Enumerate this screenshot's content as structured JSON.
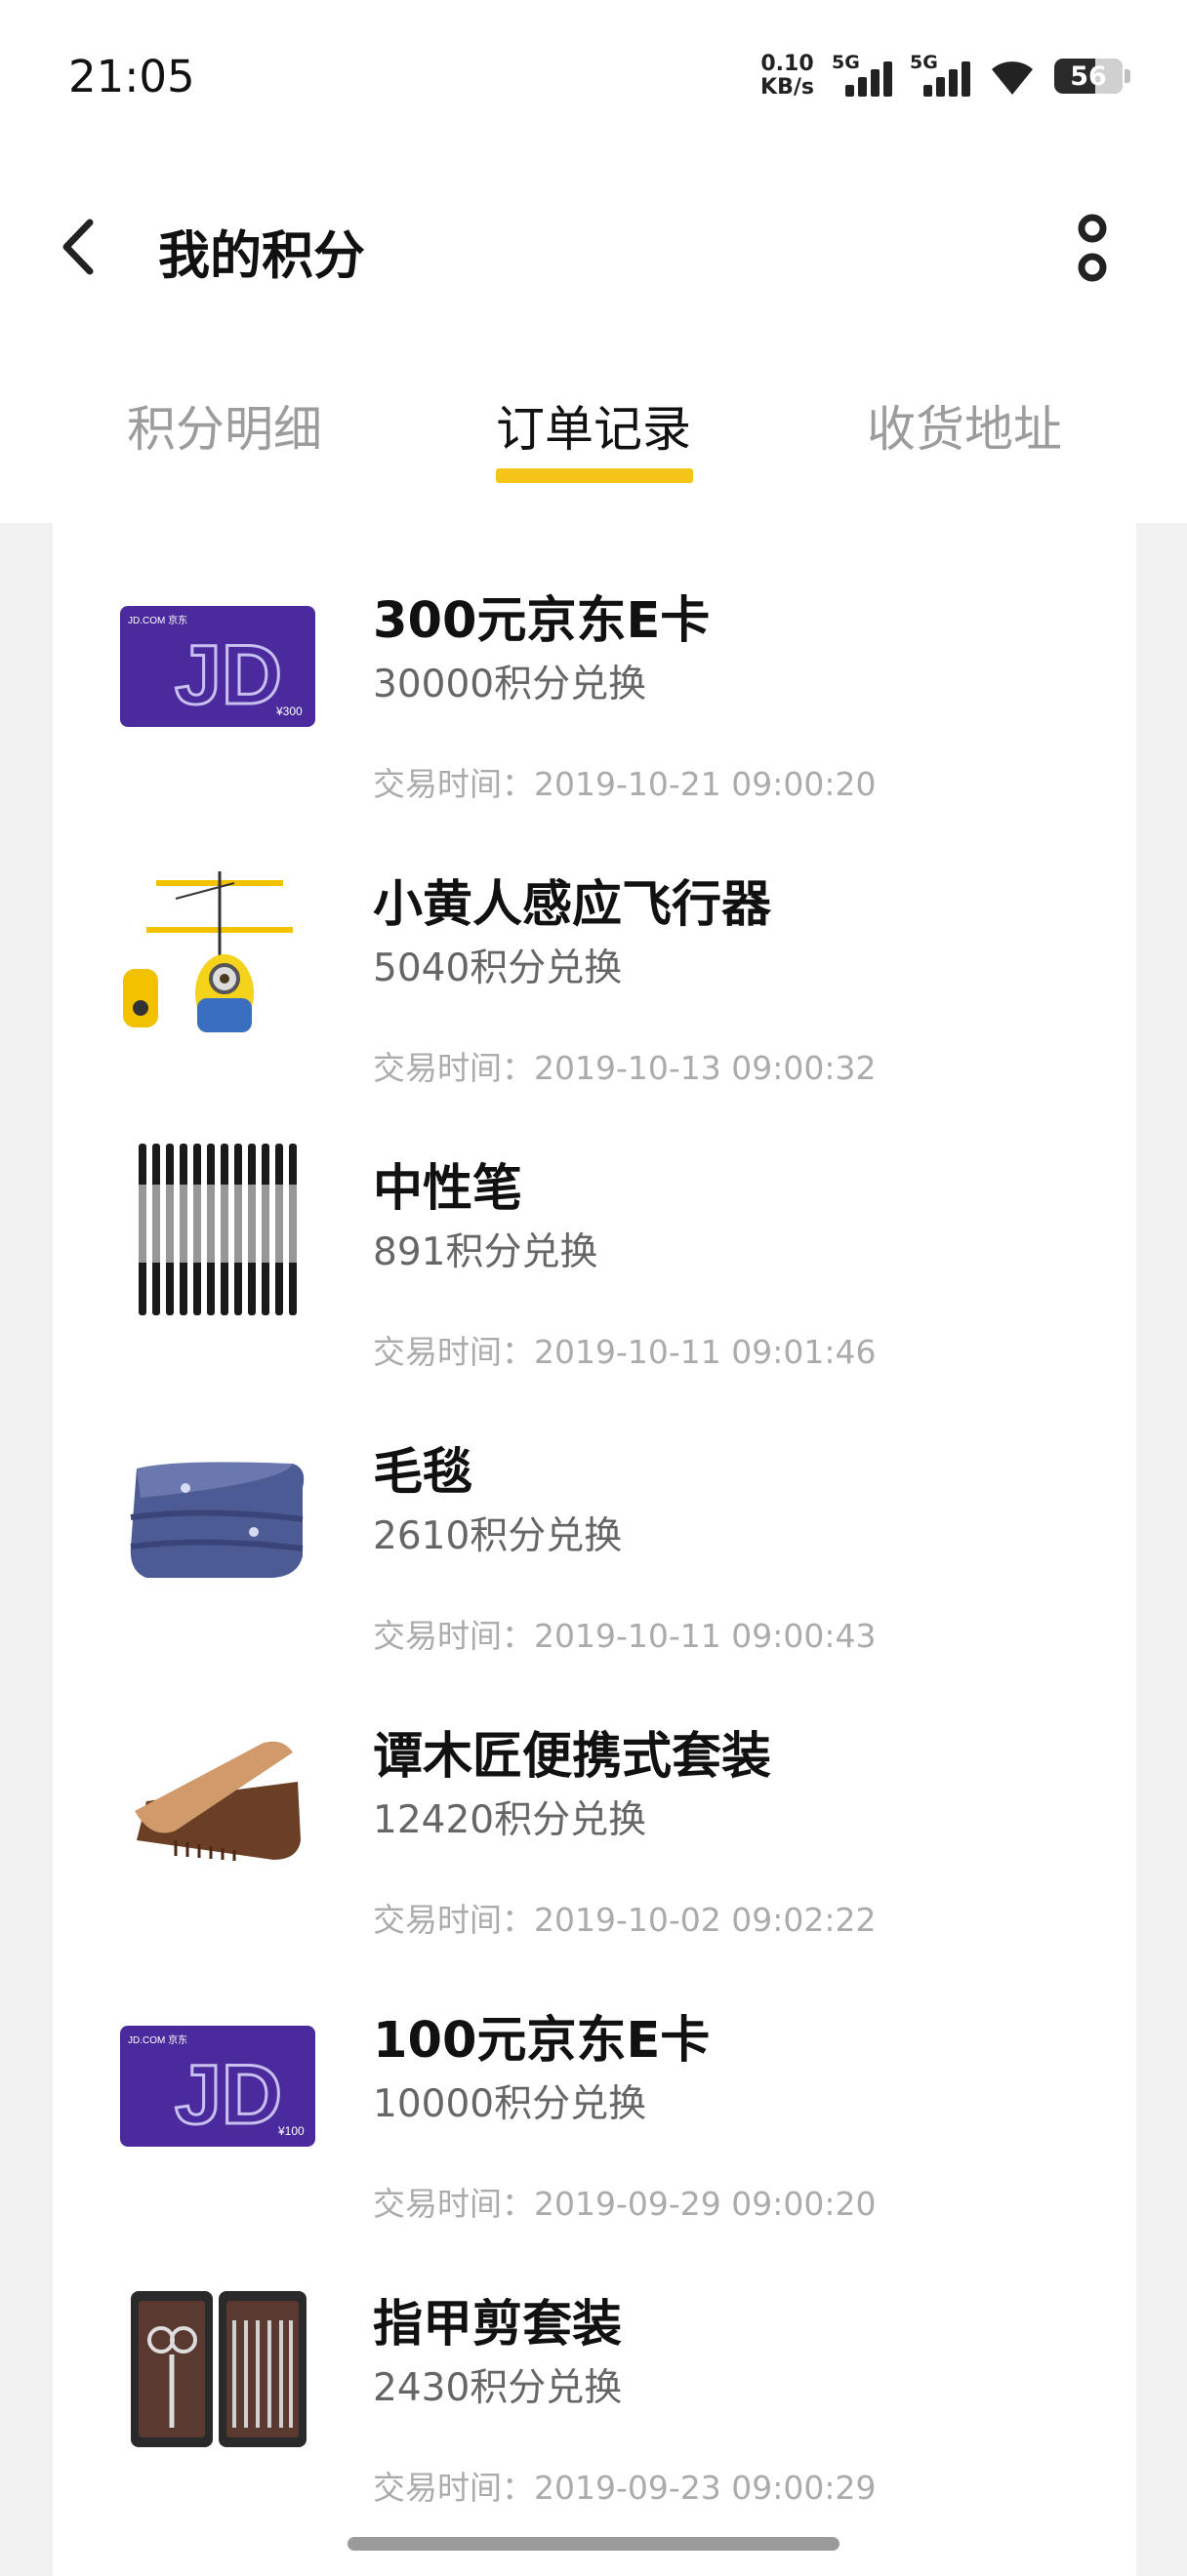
{
  "status_bar": {
    "time": "21:05",
    "net_speed_value": "0.10",
    "net_speed_unit": "KB/s",
    "signal1_label": "5G",
    "signal2_label": "5G",
    "battery_level": "56",
    "icons": [
      "wifi-icon",
      "battery-icon",
      "signal-icon"
    ]
  },
  "header": {
    "title": "我的积分",
    "back_icon": "chevron-left-icon",
    "more_icon": "more-vertical-icon"
  },
  "tabs": [
    {
      "label": "积分明细",
      "active": false
    },
    {
      "label": "订单记录",
      "active": true
    },
    {
      "label": "收货地址",
      "active": false
    }
  ],
  "accent_color": "#f5c518",
  "orders": [
    {
      "title": "300元京东E卡",
      "points": "30000积分兑换",
      "time": "交易时间：2019-10-21 09:00:20",
      "thumb": "jd-card-300",
      "card_value": "¥300",
      "card_brand": "JD.COM 京东"
    },
    {
      "title": "小黄人感应飞行器",
      "points": "5040积分兑换",
      "time": "交易时间：2019-10-13 09:00:32",
      "thumb": "minion-drone"
    },
    {
      "title": "中性笔",
      "points": "891积分兑换",
      "time": "交易时间：2019-10-11 09:01:46",
      "thumb": "gel-pens"
    },
    {
      "title": "毛毯",
      "points": "2610积分兑换",
      "time": "交易时间：2019-10-11 09:00:43",
      "thumb": "blanket"
    },
    {
      "title": "谭木匠便携式套装",
      "points": "12420积分兑换",
      "time": "交易时间：2019-10-02 09:02:22",
      "thumb": "wooden-comb-set"
    },
    {
      "title": "100元京东E卡",
      "points": "10000积分兑换",
      "time": "交易时间：2019-09-29 09:00:20",
      "thumb": "jd-card-100",
      "card_value": "¥100",
      "card_brand": "JD.COM 京东"
    },
    {
      "title": "指甲剪套装",
      "points": "2430积分兑换",
      "time": "交易时间：2019-09-23 09:00:29",
      "thumb": "nail-clipper-set"
    }
  ]
}
